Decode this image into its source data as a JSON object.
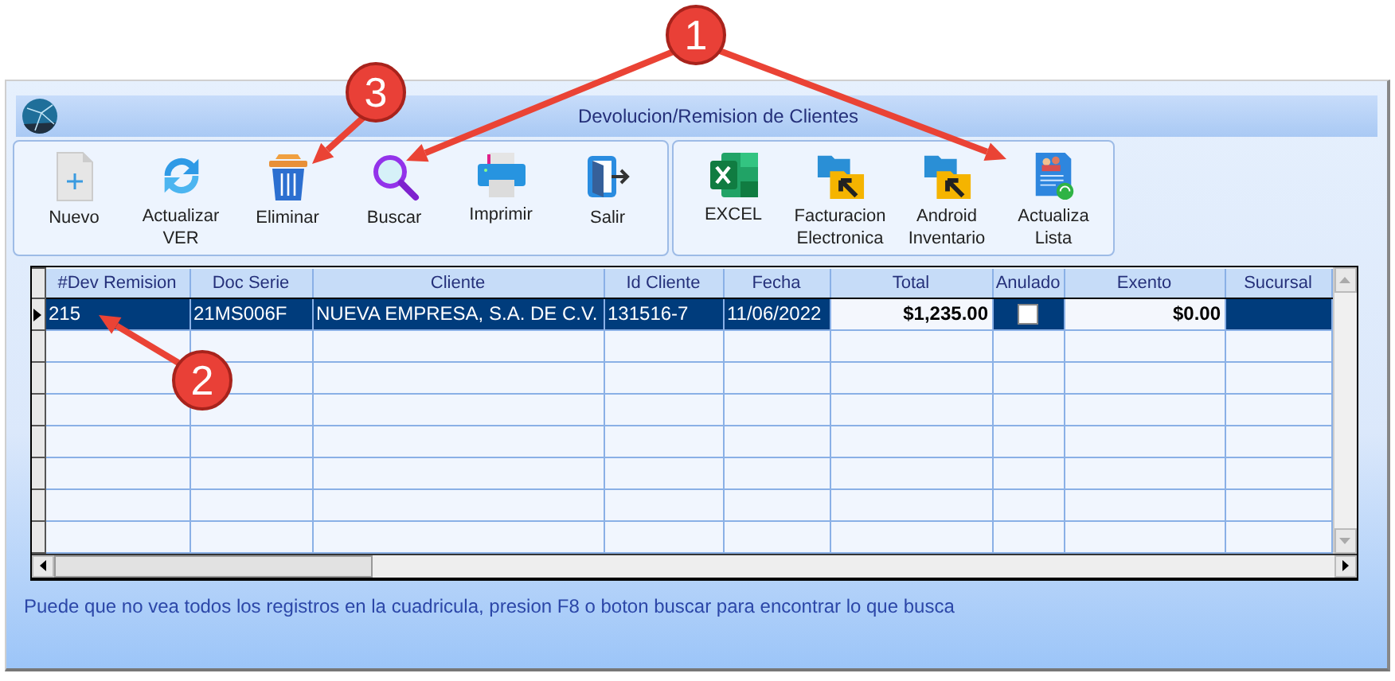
{
  "window": {
    "title": "Devolucion/Remision de Clientes"
  },
  "toolbar": {
    "groups": [
      {
        "buttons": [
          {
            "kind": "new",
            "label": "Nuevo"
          },
          {
            "kind": "refresh",
            "label": "Actualizar VER"
          },
          {
            "kind": "delete",
            "label": "Eliminar"
          },
          {
            "kind": "search",
            "label": "Buscar"
          },
          {
            "kind": "print",
            "label": "Imprimir"
          },
          {
            "kind": "exit",
            "label": "Salir"
          }
        ]
      },
      {
        "buttons": [
          {
            "kind": "excel",
            "label": "EXCEL"
          },
          {
            "kind": "folder",
            "label": "Facturacion Electronica"
          },
          {
            "kind": "folder",
            "label": "Android Inventario"
          },
          {
            "kind": "list",
            "label": "Actualiza Lista"
          }
        ]
      }
    ]
  },
  "table": {
    "columns": [
      {
        "label": "#Dev Remision",
        "kind": "text"
      },
      {
        "label": "Doc Serie",
        "kind": "text"
      },
      {
        "label": "Cliente",
        "kind": "text"
      },
      {
        "label": "Id Cliente",
        "kind": "text"
      },
      {
        "label": "Fecha",
        "kind": "text"
      },
      {
        "label": "Total",
        "kind": "money"
      },
      {
        "label": "Anulado",
        "kind": "check"
      },
      {
        "label": "Exento",
        "kind": "money"
      },
      {
        "label": "Sucursal",
        "kind": "text"
      }
    ],
    "rows": [
      {
        "selected": true,
        "values": [
          "215",
          "21MS006F",
          "NUEVA EMPRESA, S.A. DE C.V.",
          "131516-7",
          "11/06/2022",
          "$1,235.00",
          "$0.00"
        ],
        "anulado": {
          "checked": false
        }
      }
    ]
  },
  "status_text": "Puede que no vea todos los registros en la cuadricula, presion F8 o boton buscar para encontrar lo que busca",
  "annotations": [
    {
      "label": "1"
    },
    {
      "label": "2"
    },
    {
      "label": "3"
    }
  ]
}
